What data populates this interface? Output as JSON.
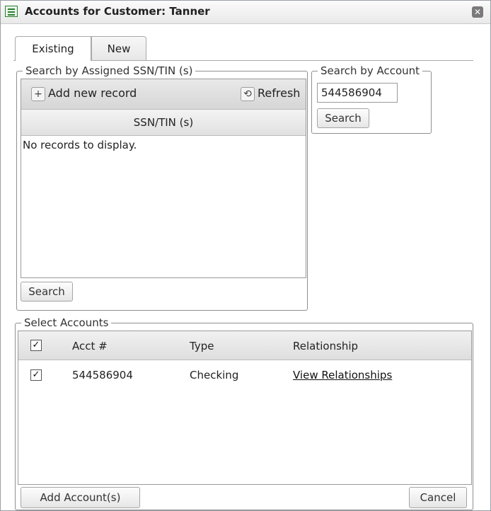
{
  "window": {
    "title": "Accounts for Customer: Tanner",
    "close_glyph": "✕"
  },
  "tabs": [
    {
      "label": "Existing",
      "active": true
    },
    {
      "label": "New",
      "active": false
    }
  ],
  "ssn_search": {
    "legend": "Search by Assigned SSN/TIN (s)",
    "toolbar": {
      "add_icon": "+",
      "add_label": "Add new record",
      "refresh_icon": "⟲",
      "refresh_label": "Refresh"
    },
    "column_header": "SSN/TIN (s)",
    "empty_message": "No records to display.",
    "search_button": "Search"
  },
  "account_search": {
    "legend": "Search by Account",
    "input_value": "544586904",
    "search_button": "Search"
  },
  "select_accounts": {
    "legend": "Select Accounts",
    "header_checkbox_checked": true,
    "columns": {
      "acct": "Acct #",
      "type": "Type",
      "relationship": "Relationship"
    },
    "rows": [
      {
        "checked": true,
        "acct": "544586904",
        "type": "Checking",
        "relationship": "View Relationships"
      }
    ],
    "check_glyph": "✓"
  },
  "footer": {
    "add_button": "Add Account(s)",
    "cancel_button": "Cancel"
  },
  "colors": {
    "icon_green": "#2f7d32",
    "border": "#9a9a9a"
  },
  "icons": [
    "list-window-icon",
    "close-icon",
    "plus-icon",
    "refresh-icon",
    "checkbox-icon"
  ]
}
